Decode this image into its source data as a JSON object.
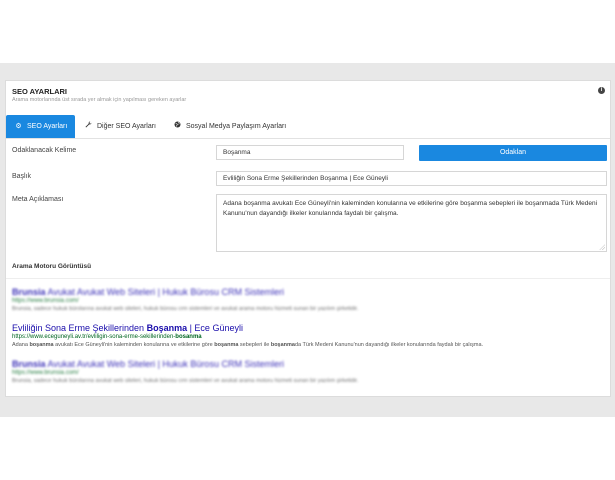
{
  "panel": {
    "title": "SEO AYARLARI",
    "subtitle": "Arama motorlarında üst sırada yer almak için yapılması gereken ayarlar",
    "info_icon": "info-icon"
  },
  "tabs": [
    {
      "label": "SEO Ayarları",
      "icon": "gear-icon",
      "glyph": "⚙",
      "active": true
    },
    {
      "label": "Diğer SEO Ayarları",
      "icon": "wrench-icon",
      "glyph": "🔧",
      "active": false
    },
    {
      "label": "Sosyal Medya Paylaşım Ayarları",
      "icon": "globe-icon",
      "glyph": "●",
      "active": false
    }
  ],
  "form": {
    "focus_keyword": {
      "label": "Odaklanacak Kelime",
      "value": "Boşanma"
    },
    "focus_button": "Odaklan",
    "title": {
      "label": "Başlık",
      "value": "Evliliğin Sona Erme Şekillerinden Boşanma | Ece Güneyli"
    },
    "meta": {
      "label": "Meta Açıklaması",
      "value": "Adana boşanma avukatı Ece Güneyli'nin kaleminden konularına ve etkilerine göre boşanma sebepleri ile boşanmada Türk Medeni Kanunu'nun dayandığı ilkeler konularında faydalı bir çalışma."
    }
  },
  "preview": {
    "section_title": "Arama Motoru Görüntüsü",
    "results": [
      {
        "title_bold": "Brunsia",
        "title_rest": " Avukat Avukat Web Siteleri | Hukuk Bürosu CRM Sistemleri",
        "url": "https://www.brunsia.com/",
        "desc": "Brunsia, sadece hukuk bürolarına avukat web siteleri, hukuk bürosu crm sistemleri ve avukat arama motoru hizmeti sunan bir yazılım şirketidir."
      },
      {
        "title_pre": "Evliliğin Sona Erme Şekillerinden ",
        "title_bold": "Boşanma",
        "title_post": " | Ece Güneyli",
        "url_pre": "https://www.eceguneyli.av.tr/evliligin-sona-erme-sekillerinden-",
        "url_bold": "bosanma",
        "desc_1": "Adana ",
        "desc_b1": "boşanma",
        "desc_2": " avukatı Ece Güneyli'nin kaleminden konularına ve etkilerine göre ",
        "desc_b2": "boşanma",
        "desc_3": " sebepleri ile ",
        "desc_b3": "boşanma",
        "desc_4": "da Türk Medeni Kanunu'nun dayandığı ilkeler konularında faydalı bir çalışma."
      },
      {
        "title_bold": "Brunsia",
        "title_rest": " Avukat Avukat Web Siteleri | Hukuk Bürosu CRM Sistemleri",
        "url": "https://www.brunsia.com/",
        "desc": "Brunsia, sadece hukuk bürolarına avukat web siteleri, hukuk bürosu crm sistemleri ve avukat arama motoru hizmeti sunan bir yazılım şirketidir."
      }
    ]
  },
  "colors": {
    "accent": "#1a88e0",
    "result_title": "#1a0dab",
    "result_url": "#006621",
    "backdrop": "#e8e8e8"
  }
}
